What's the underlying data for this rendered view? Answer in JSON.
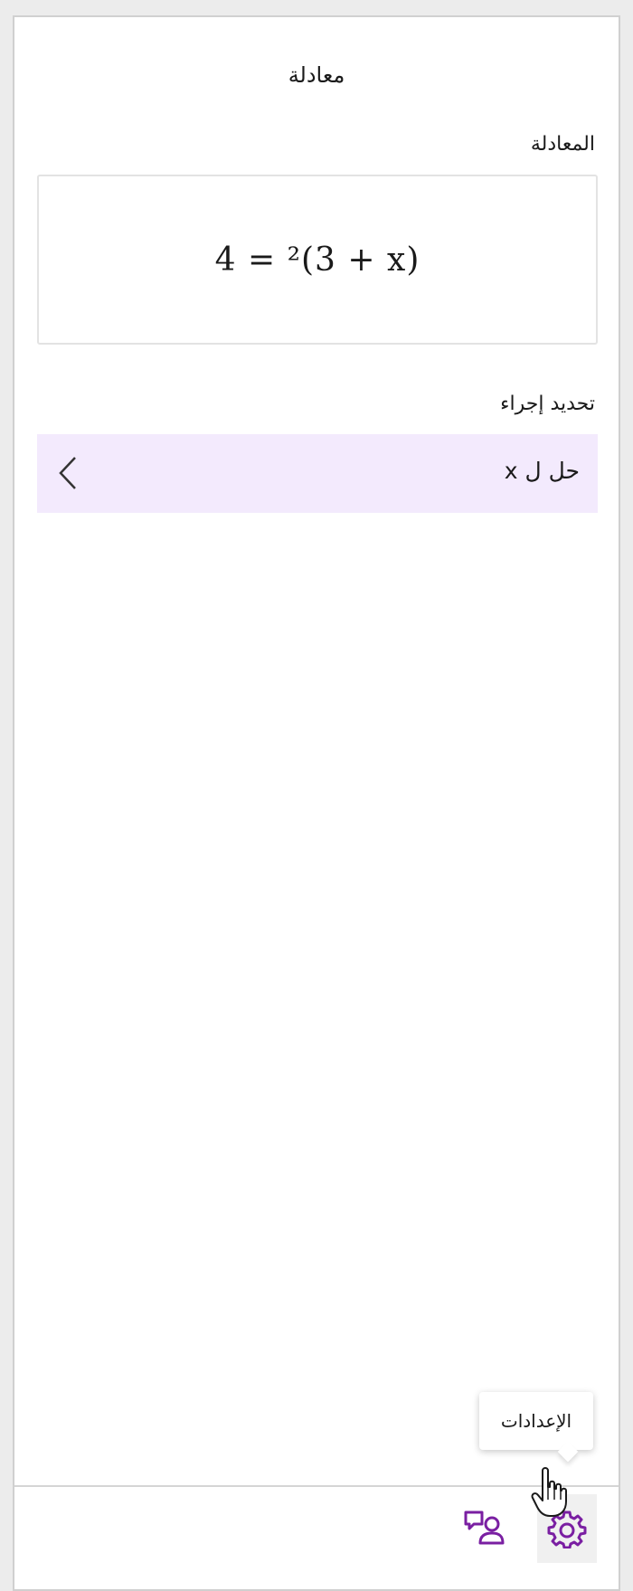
{
  "panel": {
    "title": "معادلة"
  },
  "equation_section": {
    "label": "المعادلة",
    "equation": "(x + 3)² = 4"
  },
  "action_section": {
    "label": "تحديد إجراء",
    "action_label": "حل ل x"
  },
  "bottom_bar": {
    "tooltip": "الإعدادات"
  },
  "icons": {
    "back": "chevron-left-icon",
    "feedback": "feedback-icon",
    "settings": "gear-icon",
    "cursor": "hand-cursor-icon"
  },
  "colors": {
    "accent": "#7a1fa2",
    "action_bg": "#f3eafd"
  }
}
